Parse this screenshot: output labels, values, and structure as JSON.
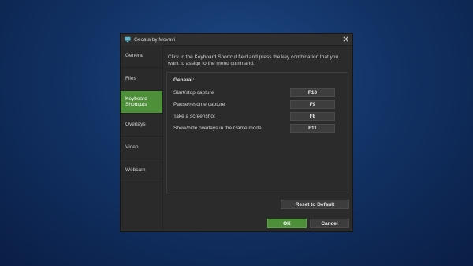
{
  "window": {
    "title": "Gecata by Movavi"
  },
  "sidebar": {
    "items": [
      {
        "label": "General"
      },
      {
        "label": "Files"
      },
      {
        "label": "Keyboard\nShortcuts"
      },
      {
        "label": "Overlays"
      },
      {
        "label": "Video"
      },
      {
        "label": "Webcam"
      }
    ]
  },
  "main": {
    "info": "Click in the Keyboard Shortcut field and press the key combination that you want to assign to the menu command.",
    "section_title": "General:",
    "shortcuts": [
      {
        "label": "Start/stop capture",
        "key": "F10"
      },
      {
        "label": "Pause/resume capture",
        "key": "F9"
      },
      {
        "label": "Take a screenshot",
        "key": "F8"
      },
      {
        "label": "Show/hide overlays in the Game mode",
        "key": "F11"
      }
    ]
  },
  "buttons": {
    "reset": "Reset to Default",
    "ok": "OK",
    "cancel": "Cancel"
  },
  "colors": {
    "accent": "#4e8f3a",
    "dialog_bg": "#2b2b2b"
  },
  "icons": {
    "app": "monitor-icon",
    "close": "close-icon"
  }
}
